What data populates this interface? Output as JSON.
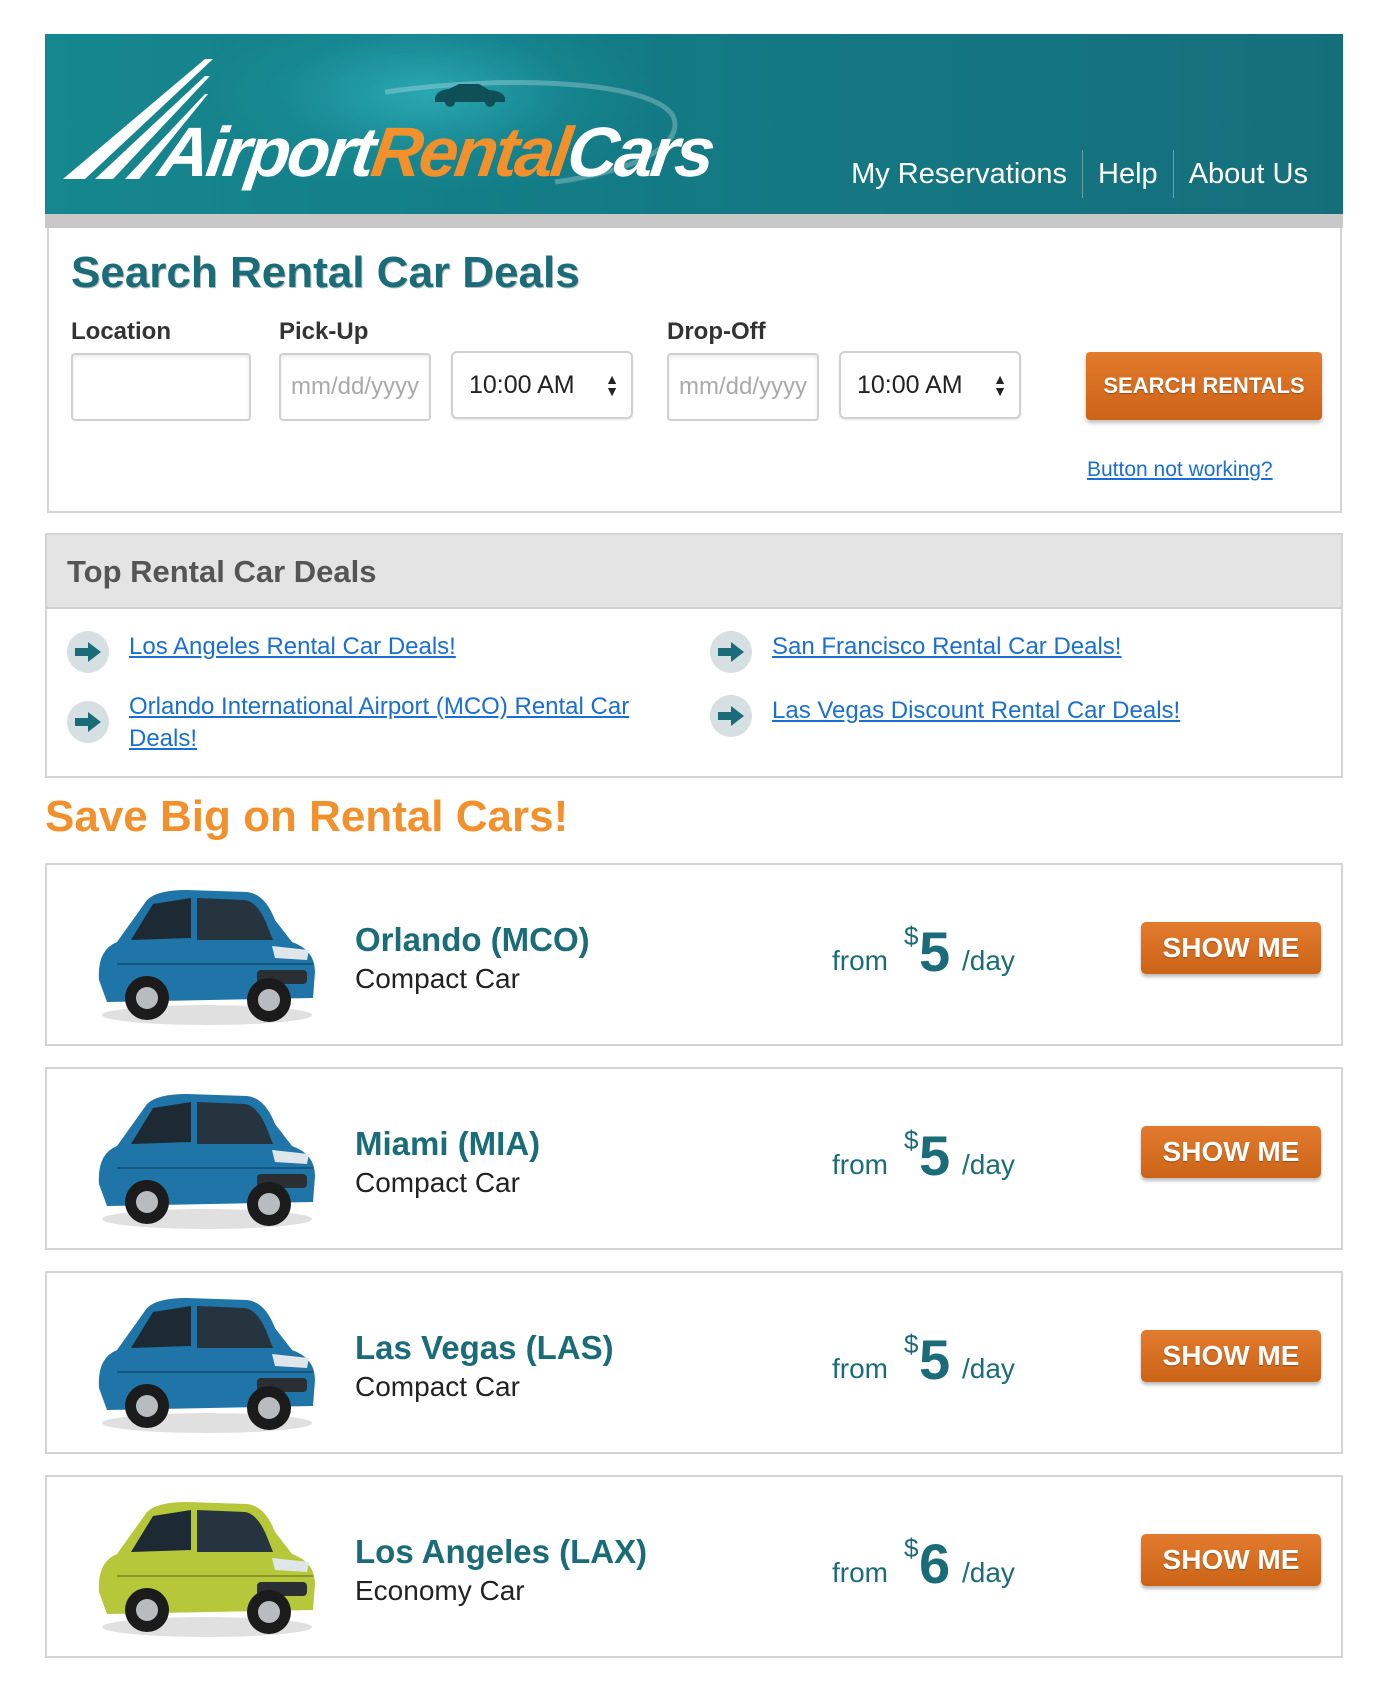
{
  "header": {
    "logo": {
      "part1": "Airport",
      "part2": "Rental",
      "part3": "Cars"
    },
    "nav": [
      "My Reservations",
      "Help",
      "About Us"
    ],
    "colors": {
      "header_bg": "#137c86",
      "accent_orange": "#f2902c"
    }
  },
  "search": {
    "title": "Search Rental Car Deals",
    "location_label": "Location",
    "location_value": "",
    "pickup_label": "Pick-Up",
    "pickup_date_placeholder": "mm/dd/yyyy",
    "pickup_time": "10:00 AM",
    "dropoff_label": "Drop-Off",
    "dropoff_date_placeholder": "mm/dd/yyyy",
    "dropoff_time": "10:00 AM",
    "button_label": "SEARCH RENTALS",
    "help_link": "Button not working?"
  },
  "deals": {
    "title": "Top Rental Car Deals",
    "links": [
      "Los Angeles Rental Car Deals!",
      "San Francisco Rental Car Deals!",
      "Orlando International Airport (MCO) Rental Car Deals!",
      "Las Vegas Discount Rental Car Deals!"
    ]
  },
  "save_title": "Save Big on Rental Cars!",
  "cars": [
    {
      "city": "Orlando (MCO)",
      "type": "Compact Car",
      "from": "from",
      "currency": "$",
      "price": "5",
      "per": "/day",
      "button": "SHOW ME",
      "car_color": "#1f74a8"
    },
    {
      "city": "Miami (MIA)",
      "type": "Compact Car",
      "from": "from",
      "currency": "$",
      "price": "5",
      "per": "/day",
      "button": "SHOW ME",
      "car_color": "#1f74a8"
    },
    {
      "city": "Las Vegas (LAS)",
      "type": "Compact Car",
      "from": "from",
      "currency": "$",
      "price": "5",
      "per": "/day",
      "button": "SHOW ME",
      "car_color": "#1f74a8"
    },
    {
      "city": "Los Angeles (LAX)",
      "type": "Economy Car",
      "from": "from",
      "currency": "$",
      "price": "6",
      "per": "/day",
      "button": "SHOW ME",
      "car_color": "#b6c83a"
    }
  ]
}
